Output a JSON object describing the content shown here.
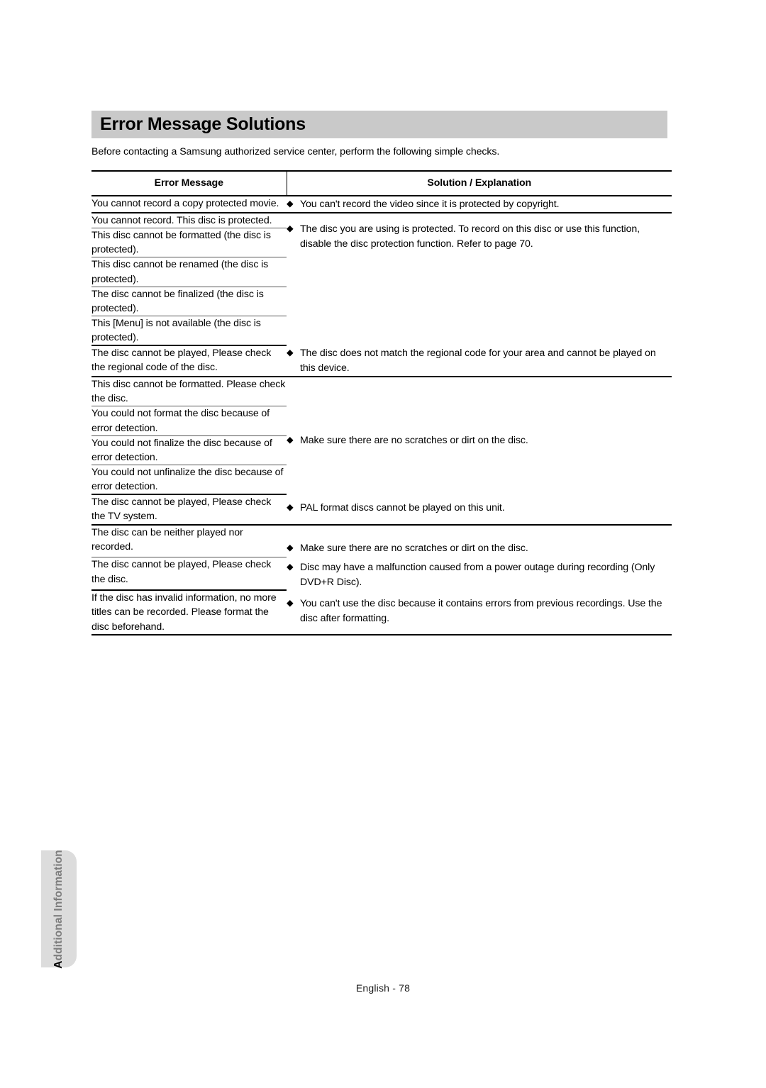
{
  "page": {
    "heading": "Error Message Solutions",
    "intro": "Before contacting a Samsung authorized service center, perform the following simple checks.",
    "side_tab": {
      "first_letter": "A",
      "rest": "dditional Information",
      "full": "Additional Information"
    },
    "footer": "English - 78"
  },
  "table": {
    "headers": {
      "col1": "Error Message",
      "col2": "Solution / Explanation"
    },
    "groups": [
      {
        "messages": [
          "You cannot record a copy protected movie."
        ],
        "solutions": [
          "You can't record the video since it is protected by copyright."
        ]
      },
      {
        "messages": [
          "You cannot record. This disc is protected.",
          "This disc cannot be formatted (the disc is protected).",
          "This disc cannot be renamed (the disc is protected).",
          "The disc cannot be finalized (the disc is protected).",
          "This [Menu] is not available (the disc is protected)."
        ],
        "solutions": [
          "The disc you are using is protected. To record on this disc or use this function, disable the disc protection function. Refer to page 70."
        ]
      },
      {
        "messages": [
          "The disc cannot be played, Please check the regional code of the disc."
        ],
        "solutions": [
          "The disc does not match the regional code for your area and cannot be played on this device."
        ]
      },
      {
        "messages": [
          "This disc cannot be formatted. Please check the disc.",
          "You could not format the disc because of error detection.",
          "You could not finalize the disc because of error detection.",
          "You could not unfinalize the disc because of error detection."
        ],
        "solutions": [
          "Make sure there are no scratches or dirt on the disc."
        ]
      },
      {
        "messages": [
          "The disc cannot be played, Please check the TV system."
        ],
        "solutions": [
          "PAL format discs cannot be played on this unit."
        ]
      },
      {
        "messages": [
          "The disc can be neither played nor recorded.",
          "The disc cannot be played, Please check the disc."
        ],
        "solutions": [
          "Make sure there are no scratches or dirt on the disc.",
          "Disc may have a malfunction caused from a power outage during recording (Only DVD+R Disc)."
        ]
      },
      {
        "messages": [
          "If the disc has invalid information, no more titles can be recorded. Please format the disc beforehand."
        ],
        "solutions": [
          "You can't use the disc because it contains errors from previous recordings. Use the disc after formatting."
        ]
      }
    ]
  },
  "icons": {
    "bullet": "◆"
  },
  "colors": {
    "heading_bar": "#c9c9c9",
    "side_tab": "#dcdcdc",
    "side_tab_text": "#7d7d7d",
    "rule": "#000000"
  }
}
